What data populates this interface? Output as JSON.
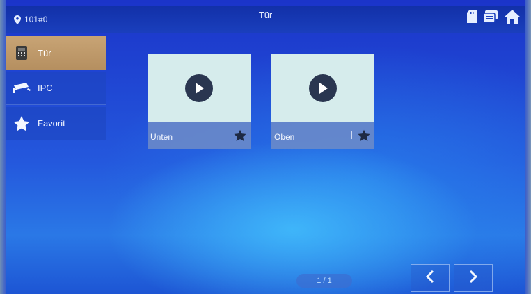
{
  "topbar": {
    "location": "101#0",
    "title": "Tür",
    "icons": [
      "location-pin-icon",
      "sd-card-icon",
      "message-icon",
      "home-icon"
    ]
  },
  "sidebar": {
    "items": [
      {
        "label": "Tür",
        "icon": "door-station-icon",
        "active": true
      },
      {
        "label": "IPC",
        "icon": "camera-icon",
        "active": false
      },
      {
        "label": "Favorit",
        "icon": "star-icon",
        "active": false
      }
    ]
  },
  "tiles": [
    {
      "name": "Unten",
      "icon": "play-icon",
      "favorite_icon": "star-icon"
    },
    {
      "name": "Oben",
      "icon": "play-icon",
      "favorite_icon": "star-icon"
    }
  ],
  "pagination": {
    "label": "1 / 1"
  },
  "nav": {
    "prev_icon": "chevron-left-icon",
    "next_icon": "chevron-right-icon"
  },
  "colors": {
    "active_item": "#c8a475",
    "thumb": "#d6ecec",
    "play": "#2a3650",
    "background": "#2458dd"
  }
}
